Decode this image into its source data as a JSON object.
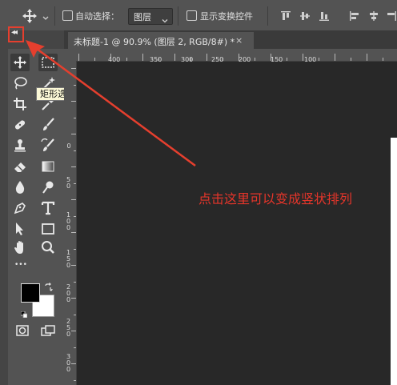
{
  "options_bar": {
    "auto_select_label": "自动选择：",
    "layer_select_value": "图层",
    "show_transform_label": "显示变换控件"
  },
  "tooltip": {
    "text": "矩形选框工具 (M)"
  },
  "document_tab": {
    "title": "未标题-1 @ 90.9% (图层 2, RGB/8#) *",
    "close_glyph": "×"
  },
  "ruler_top": {
    "ticks": [
      "400",
      "350",
      "300",
      "250",
      "200",
      "150",
      "100"
    ]
  },
  "ruler_left": {
    "ticks": [
      "0",
      "5 0",
      "1 0 0",
      "1 5 0",
      "2 0 0",
      "2 5 0",
      "3 0 0"
    ]
  },
  "annotation": {
    "text": "点击这里可以变成竖状排列"
  },
  "colors": {
    "accent_red": "#e53f2e",
    "foreground_color": "#000000",
    "background_color": "#ffffff"
  },
  "toolbar": {
    "more_glyph": "•••",
    "tools": [
      "move-icon",
      "rect-marquee-icon",
      "lasso-icon",
      "magic-wand-icon",
      "crop-icon",
      "eyedropper-icon",
      "healing-brush-icon",
      "brush-icon",
      "clone-stamp-icon",
      "history-brush-icon",
      "eraser-icon",
      "gradient-icon",
      "blur-icon",
      "dodge-icon",
      "pen-icon",
      "type-icon",
      "path-select-icon",
      "rectangle-shape-icon",
      "hand-icon",
      "zoom-icon",
      "quick-mask-icon",
      "screen-mode-icon"
    ]
  }
}
